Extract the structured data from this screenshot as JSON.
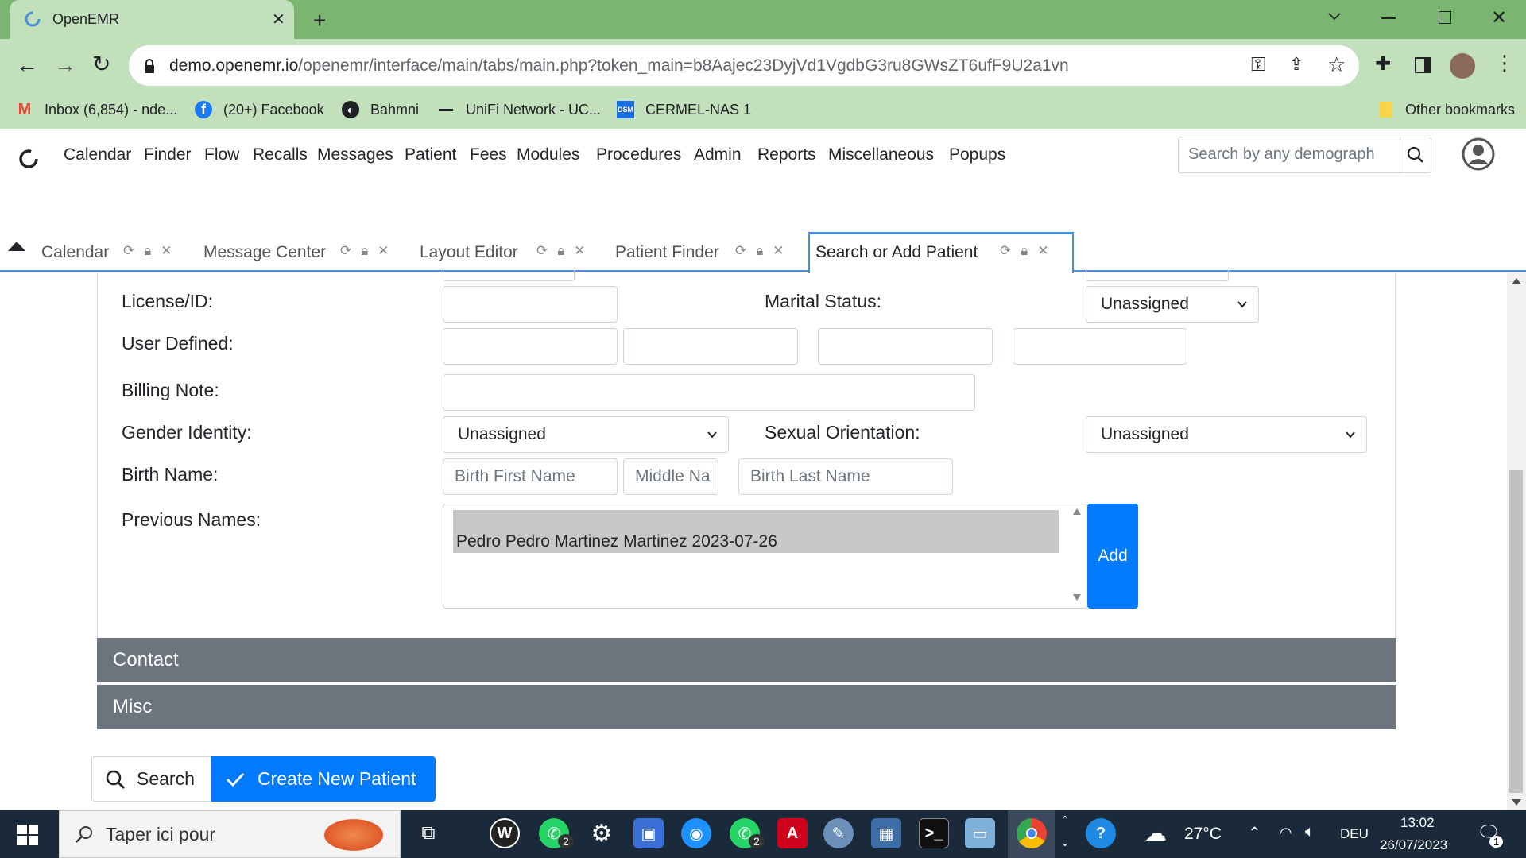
{
  "browser": {
    "tab_title": "OpenEMR",
    "url_host": "demo.openemr.io",
    "url_path": "/openemr/interface/main/tabs/main.php?token_main=b8Aajec23DyjVd1VgdbG3ru8GWsZT6ufF9U2a1vn",
    "bookmarks": [
      "Inbox (6,854) - nde...",
      "(20+) Facebook",
      "Bahmni",
      "UniFi Network - UC...",
      "CERMEL-NAS 1"
    ],
    "other_bookmarks": "Other bookmarks"
  },
  "nav": {
    "items": [
      "Calendar",
      "Finder",
      "Flow",
      "Recalls",
      "Messages",
      "Patient",
      "Fees",
      "Modules",
      "Procedures",
      "Admin",
      "Reports",
      "Miscellaneous",
      "Popups"
    ],
    "search_placeholder": "Search by any demograph"
  },
  "app_tabs": [
    {
      "label": "Calendar"
    },
    {
      "label": "Message Center"
    },
    {
      "label": "Layout Editor"
    },
    {
      "label": "Patient Finder"
    },
    {
      "label": "Search or Add Patient",
      "active": true
    }
  ],
  "form": {
    "license_label": "License/ID:",
    "marital_label": "Marital Status:",
    "marital_value": "Unassigned",
    "user_defined_label": "User Defined:",
    "billing_note_label": "Billing Note:",
    "gender_identity_label": "Gender Identity:",
    "gender_identity_value": "Unassigned",
    "sexual_orientation_label": "Sexual Orientation:",
    "sexual_orientation_value": "Unassigned",
    "birth_name_label": "Birth Name:",
    "birth_first_placeholder": "Birth First Name",
    "birth_middle_placeholder": "Middle Na",
    "birth_last_placeholder": "Birth Last Name",
    "previous_names_label": "Previous Names:",
    "previous_names": [
      "Pedro Pedro Martinez Martinez 2023-07-26"
    ],
    "add_button": "Add"
  },
  "sections": {
    "contact": "Contact",
    "misc": "Misc"
  },
  "buttons": {
    "search": "Search",
    "create": "Create New Patient"
  },
  "taskbar": {
    "search_text": "Taper ici pour",
    "temperature": "27°C",
    "language": "DEU",
    "time": "13:02",
    "date": "26/07/2023",
    "whatsapp_badge_1": "2",
    "whatsapp_badge_2": "2",
    "notification_count": "1"
  },
  "colors": {
    "chrome_tab": "#7cb572",
    "chrome_toolbar": "#c3e0bc",
    "primary": "#007bff",
    "section": "#6c757d",
    "active_tab_border": "#4a90d9"
  }
}
